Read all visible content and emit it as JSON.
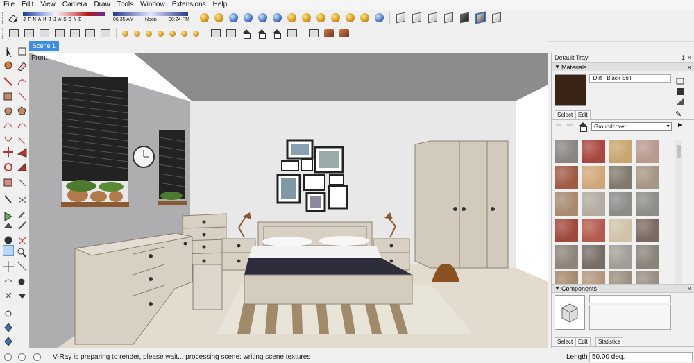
{
  "menu": [
    "File",
    "Edit",
    "View",
    "Camera",
    "Draw",
    "Tools",
    "Window",
    "Extensions",
    "Help"
  ],
  "shadow_settings": {
    "month_initials": "JFMAMJJASOND",
    "time_start": "06:35 AM",
    "time_noon": "Noon",
    "time_end": "06:24 PM"
  },
  "scene_tab": "Scene 1",
  "viewport": {
    "view_label": "Front",
    "cursor_icon": "arrow-cursor"
  },
  "tray": {
    "title": "Default Tray",
    "pin": "↥ ×",
    "materials": {
      "header": "Materials",
      "close": "×",
      "current_name": "-Dirt - Black Soil",
      "current_color": "#3a2418",
      "tabs": [
        "Select",
        "Edit"
      ],
      "library": "Groundcover",
      "swatch_colors": [
        [
          "#8a8580",
          "#a8473f",
          "#c9a670",
          "#b89a8e"
        ],
        [
          "#a15a45",
          "#d1a779",
          "#7f7a6e",
          "#a59685"
        ],
        [
          "#a98a70",
          "#b3aba2",
          "#8e8c89",
          "#8d8d8a"
        ],
        [
          "#a0483c",
          "#b55a4e",
          "#d0c2a8",
          "#7a6a62"
        ],
        [
          "#8f8479",
          "#766e66",
          "#a29d96",
          "#89837a"
        ],
        [
          "#a68a6e",
          "#b4967b",
          "#9b8e80",
          "#998d82"
        ]
      ]
    },
    "components": {
      "header": "Components",
      "close": "×",
      "tabs": [
        "Select",
        "Edit",
        "Statistics"
      ]
    }
  },
  "status": {
    "message": "V-Ray is preparing to render, please wait... processing scene: writing scene textures",
    "measure_label": "Length",
    "measure_value": "50.00 deg."
  }
}
